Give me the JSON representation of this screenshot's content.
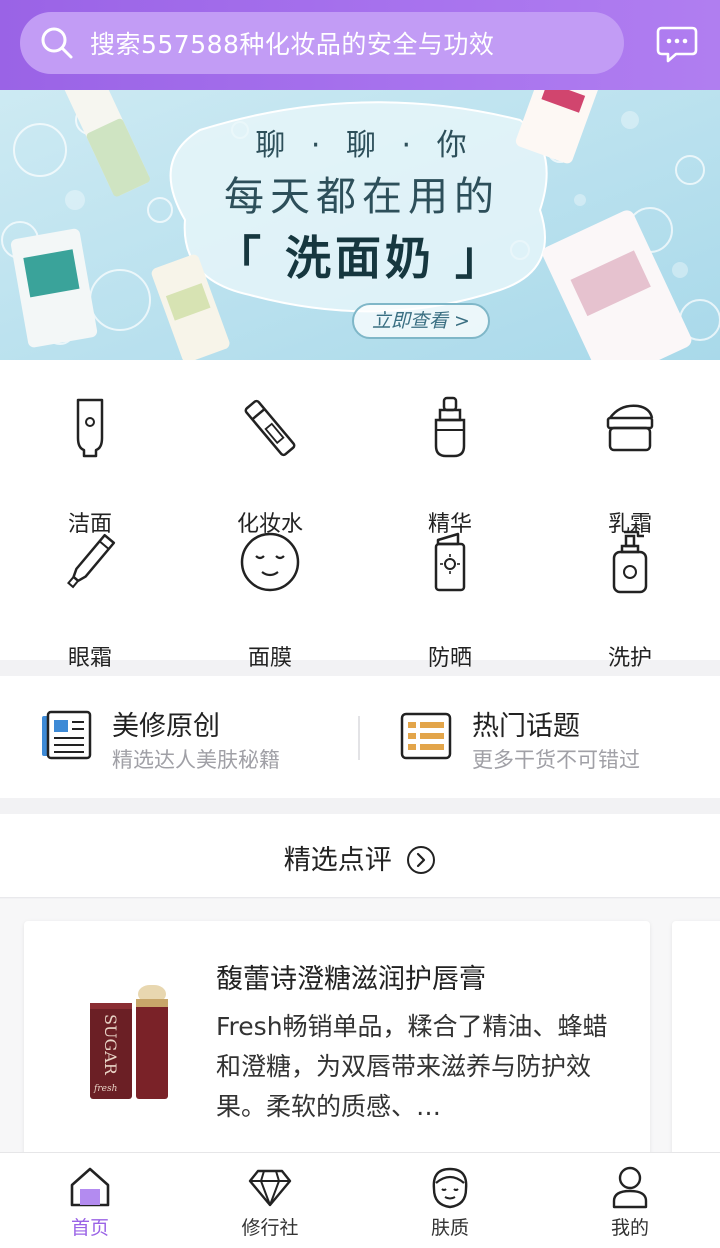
{
  "search": {
    "placeholder": "搜索557588种化妆品的安全与功效"
  },
  "banner": {
    "line1": "聊 · 聊 · 你",
    "line2": "每天都在用的",
    "line3": "「 洗面奶 」",
    "cta": "立即查看 >"
  },
  "categories": [
    {
      "label": "洁面",
      "icon": "cleanser-tube-icon"
    },
    {
      "label": "化妆水",
      "icon": "toner-bottle-icon"
    },
    {
      "label": "精华",
      "icon": "serum-dropper-icon"
    },
    {
      "label": "乳霜",
      "icon": "cream-jar-icon"
    },
    {
      "label": "眼霜",
      "icon": "eye-cream-tube-icon"
    },
    {
      "label": "面膜",
      "icon": "face-mask-icon"
    },
    {
      "label": "防晒",
      "icon": "sunscreen-bottle-icon"
    },
    {
      "label": "洗护",
      "icon": "pump-bottle-icon"
    }
  ],
  "features": [
    {
      "title": "美修原创",
      "subtitle": "精选达人美肤秘籍",
      "icon": "newspaper-icon"
    },
    {
      "title": "热门话题",
      "subtitle": "更多干货不可错过",
      "icon": "topic-list-icon"
    }
  ],
  "section": {
    "title": "精选点评"
  },
  "review": {
    "title": "馥蕾诗澄糖滋润护唇膏",
    "description": "Fresh畅销单品，糅合了精油、蜂蜡和澄糖，为双唇带来滋养与防护效果。柔软的质感、…"
  },
  "tabs": [
    {
      "label": "首页",
      "active": true,
      "icon": "home-icon"
    },
    {
      "label": "修行社",
      "active": false,
      "icon": "diamond-icon"
    },
    {
      "label": "肤质",
      "active": false,
      "icon": "face-icon"
    },
    {
      "label": "我的",
      "active": false,
      "icon": "user-icon"
    }
  ],
  "colors": {
    "brand": "#9a63e6",
    "searchBg": "#c29cf5"
  }
}
